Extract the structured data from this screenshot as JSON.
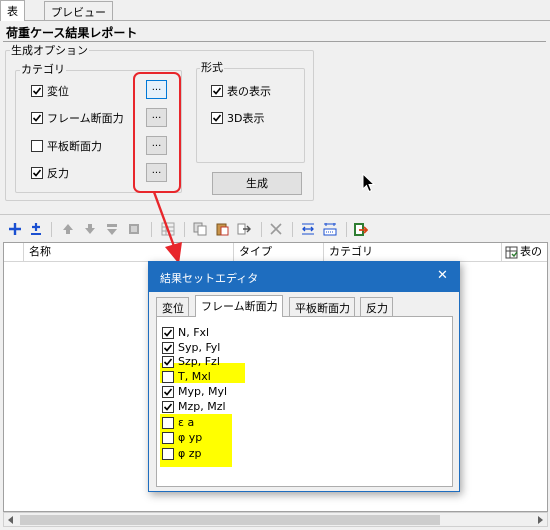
{
  "tabs": [
    "表",
    "プレビュー"
  ],
  "report_title": "荷重ケース結果レポート",
  "options": {
    "legend": "生成オプション",
    "category_legend": "カテゴリ",
    "categories": [
      {
        "label": "変位",
        "checked": true
      },
      {
        "label": "フレーム断面力",
        "checked": true
      },
      {
        "label": "平板断面力",
        "checked": false
      },
      {
        "label": "反力",
        "checked": true
      }
    ],
    "ellipsis_label": "...",
    "format_legend": "形式",
    "formats": [
      {
        "label": "表の表示",
        "checked": true
      },
      {
        "label": "3D表示",
        "checked": true
      }
    ],
    "generate_label": "生成"
  },
  "table": {
    "columns": [
      "名称",
      "タイプ",
      "カテゴリ",
      "表の"
    ]
  },
  "dialog": {
    "title": "結果セットエディタ",
    "close": "✕",
    "tabs": [
      "変位",
      "フレーム断面力",
      "平板断面力",
      "反力"
    ],
    "active_tab": "フレーム断面力",
    "items": [
      {
        "label": "N, Fxl",
        "checked": true,
        "highlight": false
      },
      {
        "label": "Syp, Fyl",
        "checked": true,
        "highlight": false
      },
      {
        "label": "Szp, Fzl",
        "checked": true,
        "highlight": false
      },
      {
        "label": "T, Mxl",
        "checked": false,
        "highlight": true
      },
      {
        "label": "Myp, Myl",
        "checked": true,
        "highlight": false
      },
      {
        "label": "Mzp, Mzl",
        "checked": true,
        "highlight": false
      },
      {
        "label": "ε a",
        "checked": false,
        "highlight": true
      },
      {
        "label": "φ yp",
        "checked": false,
        "highlight": true
      },
      {
        "label": "φ zp",
        "checked": false,
        "highlight": true
      }
    ]
  },
  "colors": {
    "annotation_red": "#e8262b",
    "highlight_yellow": "#ffff00",
    "dialog_blue": "#1e6dbf"
  }
}
